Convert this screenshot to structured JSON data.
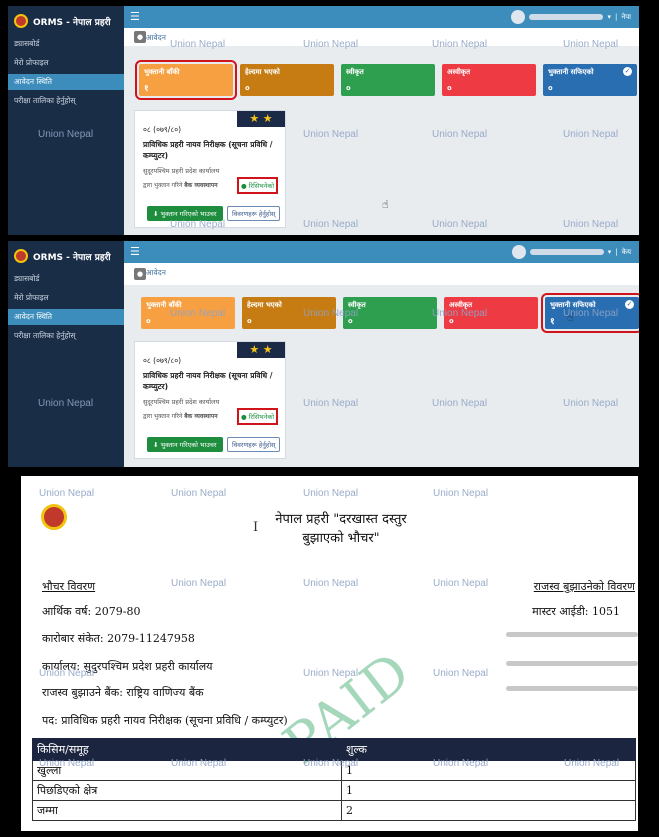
{
  "app": {
    "title": "ORMS - नेपाल प्रहरी"
  },
  "watermark": "Union Nepal",
  "sidebar": {
    "items": [
      {
        "label": "ड्यासबोर्ड"
      },
      {
        "label": "मेरो प्रोफाइल"
      },
      {
        "label": "आवेदन स्थिति"
      },
      {
        "label": "परीक्षा तालिका हेर्नुहोस्"
      }
    ]
  },
  "topbar": {
    "menu_icon": "menu-icon",
    "user_link_1": "नेपा",
    "user_link_2": "केय"
  },
  "breadcrumb": "मेरो आवेदन",
  "status_cards": [
    {
      "label": "भुक्तानी बाँकी",
      "color": "#f7a042"
    },
    {
      "label": "हेल्दमा भएको",
      "count": "०",
      "color": "#c67c12"
    },
    {
      "label": "स्वीकृत",
      "count": "०",
      "color": "#2e9e4f"
    },
    {
      "label": "अस्वीकृत",
      "count": "०",
      "color": "#ee3b43"
    },
    {
      "label": "भुक्तानी सफिएको",
      "color": "#2a6eb2"
    }
  ],
  "panel1_counts": {
    "pending": "१",
    "paid": "०"
  },
  "panel2_counts": {
    "pending": "०",
    "paid": "१"
  },
  "application": {
    "code": "०८ (०७९/८०)",
    "post": "प्राविधिक प्रहरी नायव निरीक्षक (सूचना प्रविधि / कम्प्युटर)",
    "office": "सुदूरपश्चिम प्रहरी प्रदेश कार्यालय",
    "pay_label": "द्वारा भुक्तान गरिने",
    "pay_method": "बैक व्यवस्थापन",
    "status": "रिसिभनेको",
    "download_button": "भुक्तान गरिएको भाउचर",
    "details_button": "विवरणहरू हेर्नुहोस्"
  },
  "voucher": {
    "title_line1": "नेपाल प्रहरी \"दरखास्त दस्तुर",
    "title_line2": "बुझाएको भौचर\"",
    "section_left": "भौचर विवरण",
    "section_right": "राजस्व बुझाउनेको विवरण",
    "fiscal_year": "आर्थिक वर्ष: 2079-80",
    "txn_code": "कारोबार संकेत: 2079-11247958",
    "office": "कार्यालय: सुदुरपश्चिम प्रदेश प्रहरी कार्यालय",
    "bank": "राजस्व बुझाउने बैंक: राष्ट्रिय वाणिज्य बैंक",
    "post": "पद: प्राविधिक प्रहरी नायव निरीक्षक (सूचना प्रविधि / कम्प्युटर)",
    "master_id": "मास्टर आईडी: 1051",
    "stamp": "PAID",
    "table": {
      "headers": [
        "किसिम/समूह",
        "शुल्क"
      ],
      "rows": [
        [
          "खुल्ला",
          "1"
        ],
        [
          "पिछडिएको क्षेत्र",
          "1"
        ],
        [
          "जम्मा",
          "2"
        ]
      ]
    }
  }
}
